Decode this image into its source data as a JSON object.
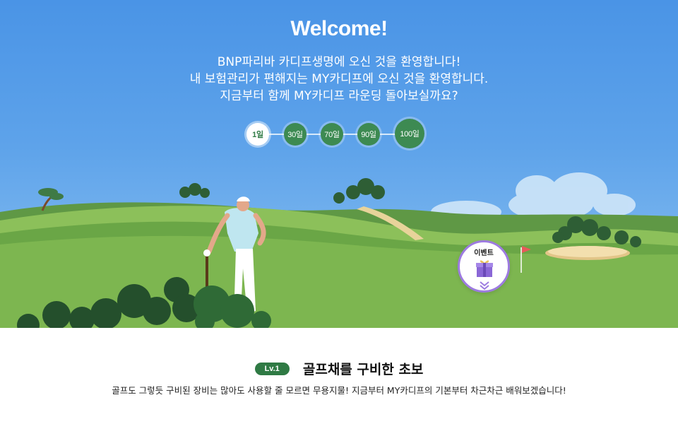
{
  "hero": {
    "title": "Welcome!",
    "intro_lines": [
      "BNP파리바 카디프생명에 오신 것을 환영합니다!",
      "내 보험관리가 편해지는 MY카디프에 오신 것을 환영합니다.",
      "지금부터 함께 MY카디프 라운딩 돌아보실까요?"
    ]
  },
  "steps": [
    {
      "label": "1일",
      "active": true
    },
    {
      "label": "30일",
      "active": false
    },
    {
      "label": "70일",
      "active": false
    },
    {
      "label": "90일",
      "active": false
    },
    {
      "label": "100일",
      "active": false
    }
  ],
  "event": {
    "label": "이벤트",
    "icon": "gift-icon",
    "arrow_icon": "double-chevron-down-icon"
  },
  "level": {
    "badge": "Lv.1",
    "title": "골프채를 구비한 초보",
    "description": "골프도 그렇듯 구비된 장비는 많아도 사용할 줄 모르면 무용지물! 지금부터 MY카디프의 기본부터 차근차근 배워보겠습니다!"
  },
  "colors": {
    "sky": "#4a94e6",
    "grass": "#7cb34f",
    "accent_green": "#2f7a44",
    "event_purple": "#9d7be0"
  }
}
